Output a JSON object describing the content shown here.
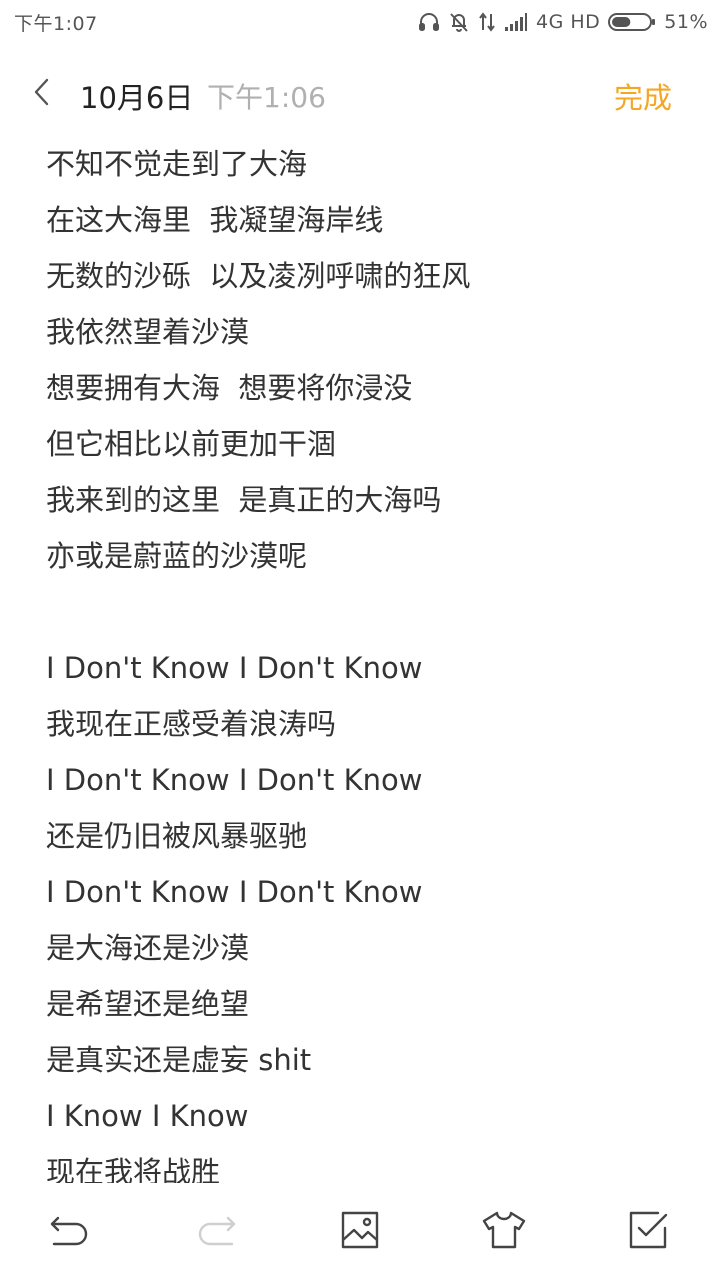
{
  "status_bar": {
    "time": "下午1:07",
    "network": "4G HD",
    "battery": "51%",
    "battery_level": 0.51,
    "icons": [
      "headset-icon",
      "mute-icon",
      "data-transfer-icon",
      "signal-icon",
      "battery-icon"
    ]
  },
  "header": {
    "back_icon": "chevron-left-icon",
    "date": "10月6日",
    "time": "下午1:06",
    "done_label": "完成",
    "accent_color": "#f5a623"
  },
  "note": {
    "lines": [
      "不知不觉走到了大海",
      "在这大海里  我凝望海岸线",
      "无数的沙砾  以及凌冽呼啸的狂风",
      "我依然望着沙漠",
      "想要拥有大海  想要将你浸没",
      "但它相比以前更加干涸",
      "我来到的这里  是真正的大海吗",
      "亦或是蔚蓝的沙漠呢",
      "",
      "I Don't Know I Don't Know",
      "我现在正感受着浪涛吗",
      "I Don't Know I Don't Know",
      "还是仍旧被风暴驱驰",
      "I Don't Know I Don't Know",
      "是大海还是沙漠",
      "是希望还是绝望",
      "是真实还是虚妄 shit",
      "I Know I Know",
      "现在我将战胜"
    ]
  },
  "toolbar": {
    "items": [
      {
        "name": "undo",
        "icon": "undo-icon",
        "enabled": true
      },
      {
        "name": "redo",
        "icon": "redo-icon",
        "enabled": false
      },
      {
        "name": "insert-image",
        "icon": "image-icon",
        "enabled": true
      },
      {
        "name": "theme",
        "icon": "tshirt-icon",
        "enabled": true
      },
      {
        "name": "checklist",
        "icon": "checkbox-icon",
        "enabled": true
      }
    ]
  }
}
